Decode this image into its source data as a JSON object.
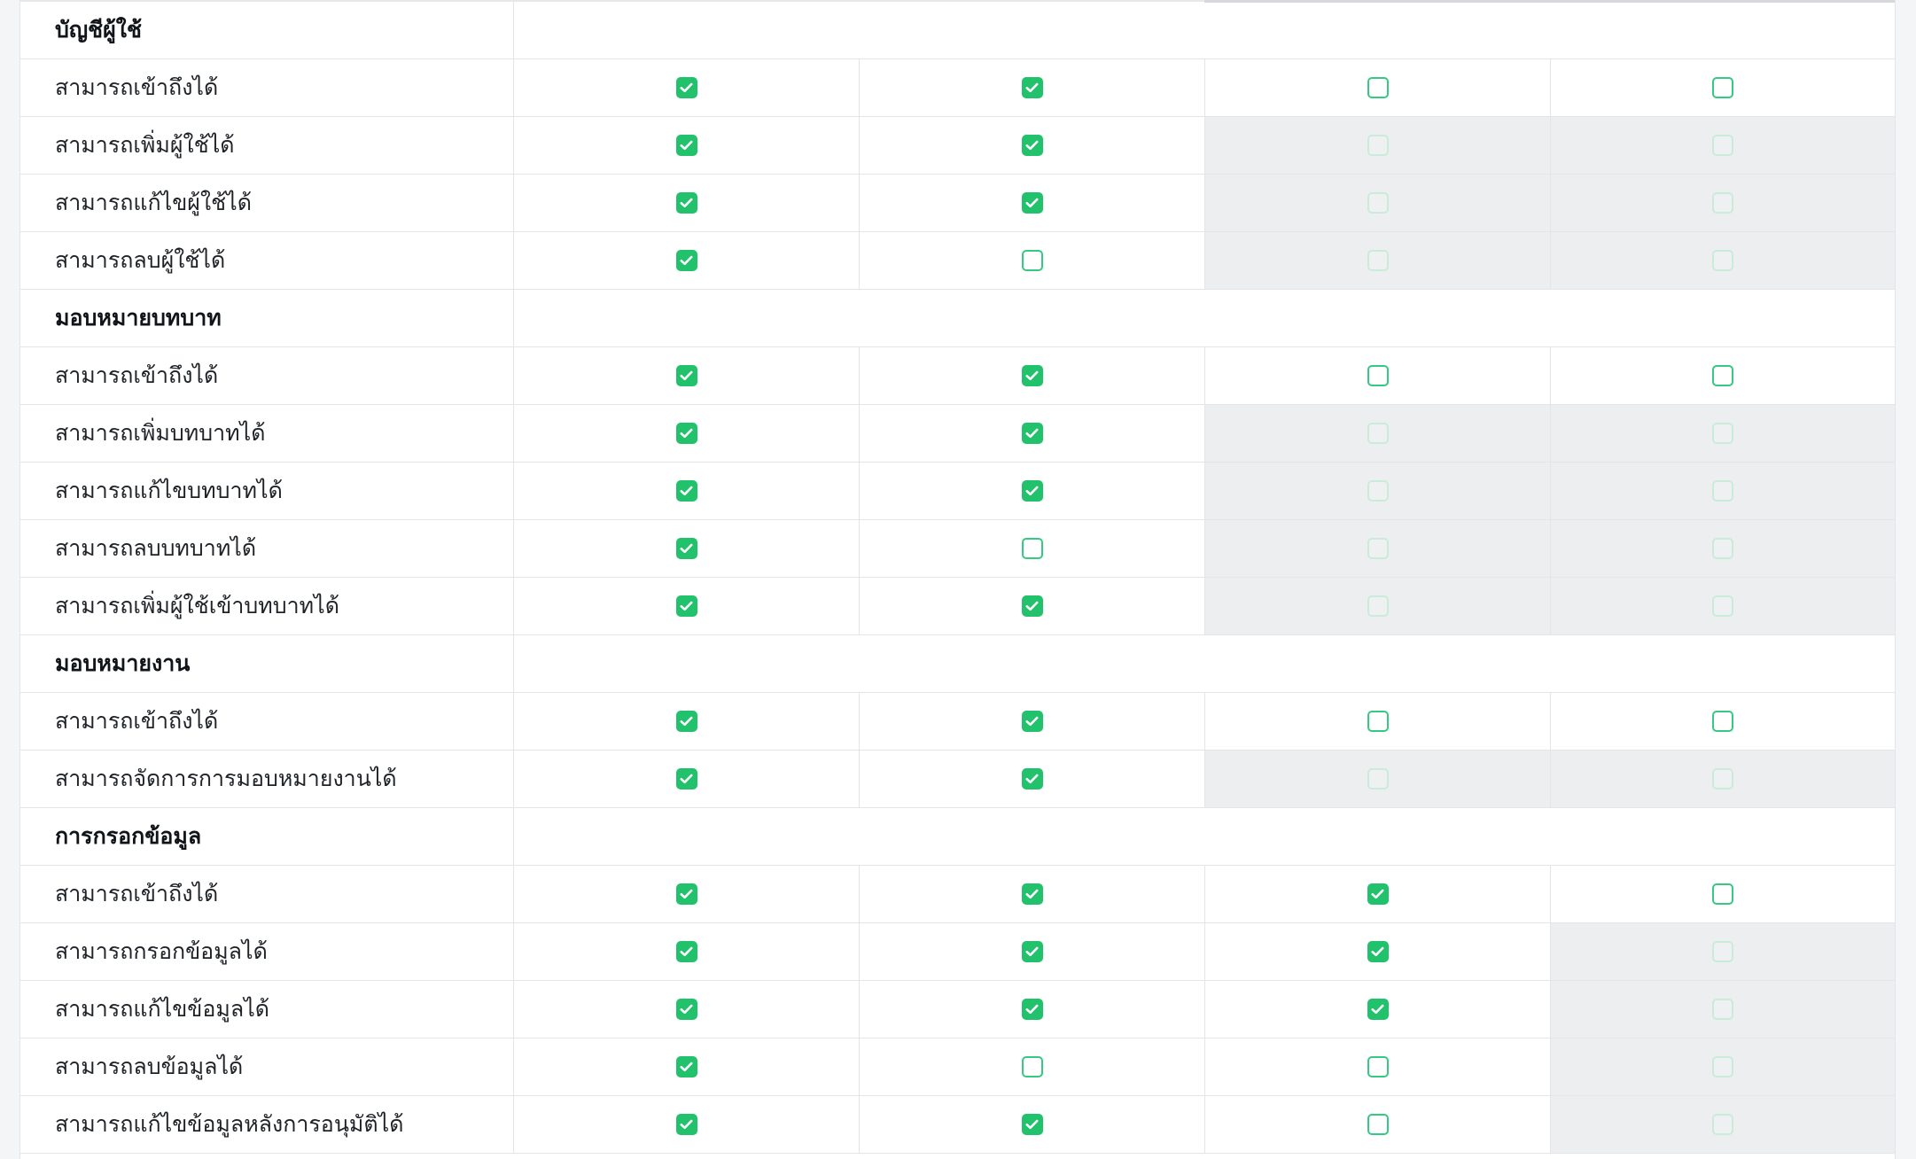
{
  "colors": {
    "checked": "#22c16b",
    "unchecked_border": "#35c983",
    "disabled_bg": "#eceef0"
  },
  "icons": {
    "checked": "check-icon"
  },
  "sections": [
    {
      "title": "บัญชีผู้ใช้",
      "rows": [
        {
          "label": "สามารถเข้าถึงได้",
          "cells": [
            "checked",
            "checked",
            "unchecked",
            "unchecked"
          ]
        },
        {
          "label": "สามารถเพิ่มผู้ใช้ได้",
          "cells": [
            "checked",
            "checked",
            "disabled",
            "disabled"
          ]
        },
        {
          "label": "สามารถแก้ไขผู้ใช้ได้",
          "cells": [
            "checked",
            "checked",
            "disabled",
            "disabled"
          ]
        },
        {
          "label": "สามารถลบผู้ใช้ได้",
          "cells": [
            "checked",
            "unchecked",
            "disabled",
            "disabled"
          ]
        }
      ]
    },
    {
      "title": "มอบหมายบทบาท",
      "rows": [
        {
          "label": "สามารถเข้าถึงได้",
          "cells": [
            "checked",
            "checked",
            "unchecked",
            "unchecked"
          ]
        },
        {
          "label": "สามารถเพิ่มบทบาทได้",
          "cells": [
            "checked",
            "checked",
            "disabled",
            "disabled"
          ]
        },
        {
          "label": "สามารถแก้ไขบทบาทได้",
          "cells": [
            "checked",
            "checked",
            "disabled",
            "disabled"
          ]
        },
        {
          "label": "สามารถลบบทบาทได้",
          "cells": [
            "checked",
            "unchecked",
            "disabled",
            "disabled"
          ]
        },
        {
          "label": "สามารถเพิ่มผู้ใช้เข้าบทบาทได้",
          "cells": [
            "checked",
            "checked",
            "disabled",
            "disabled"
          ]
        }
      ]
    },
    {
      "title": "มอบหมายงาน",
      "rows": [
        {
          "label": "สามารถเข้าถึงได้",
          "cells": [
            "checked",
            "checked",
            "unchecked",
            "unchecked"
          ]
        },
        {
          "label": "สามารถจัดการการมอบหมายงานได้",
          "cells": [
            "checked",
            "checked",
            "disabled",
            "disabled"
          ]
        }
      ]
    },
    {
      "title": "การกรอกข้อมูล",
      "rows": [
        {
          "label": "สามารถเข้าถึงได้",
          "cells": [
            "checked",
            "checked",
            "checked",
            "unchecked"
          ]
        },
        {
          "label": "สามารถกรอกข้อมูลได้",
          "cells": [
            "checked",
            "checked",
            "checked",
            "disabled"
          ]
        },
        {
          "label": "สามารถแก้ไขข้อมูลได้",
          "cells": [
            "checked",
            "checked",
            "checked",
            "disabled"
          ]
        },
        {
          "label": "สามารถลบข้อมูลได้",
          "cells": [
            "checked",
            "unchecked",
            "unchecked",
            "disabled"
          ]
        },
        {
          "label": "สามารถแก้ไขข้อมูลหลังการอนุมัติได้",
          "cells": [
            "checked",
            "checked",
            "unchecked",
            "disabled"
          ]
        }
      ]
    }
  ]
}
